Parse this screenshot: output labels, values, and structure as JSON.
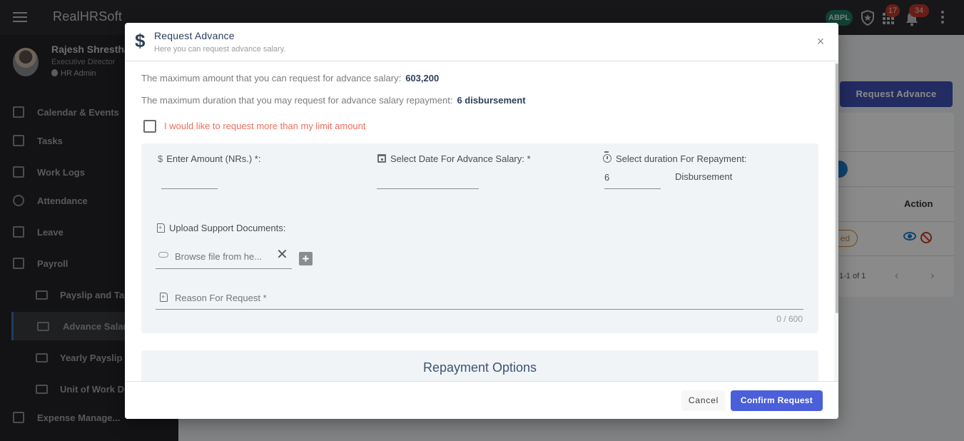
{
  "app": {
    "brand": "RealHRSoft",
    "company_badge": "ABPL",
    "apps_badge_count": "17",
    "notifications_count": "34"
  },
  "profile": {
    "name": "Rajesh Shrestha",
    "role": "Executive Director",
    "admin_label": "HR Admin"
  },
  "sidebar": {
    "items": [
      {
        "label": "Calendar & Events",
        "icon": "calendar-icon"
      },
      {
        "label": "Tasks",
        "icon": "tasks-icon"
      },
      {
        "label": "Work Logs",
        "icon": "clipboard-icon"
      },
      {
        "label": "Attendance",
        "icon": "fingerprint-icon"
      },
      {
        "label": "Leave",
        "icon": "calendar-x-icon"
      },
      {
        "label": "Payroll",
        "icon": "calculator-icon"
      },
      {
        "label": "Payslip and Tax",
        "icon": "money-icon"
      },
      {
        "label": "Advance Salary",
        "icon": "dollar-bill-icon",
        "active": true
      },
      {
        "label": "Yearly Payslip",
        "icon": "dollar-bill-icon"
      },
      {
        "label": "Unit of Work Done",
        "icon": "dollar-bill-icon"
      },
      {
        "label": "Expense Manage...",
        "icon": "clipboard-icon"
      }
    ]
  },
  "background_page": {
    "request_button": "Request Advance",
    "table_header_action": "Action",
    "status_fragment": "ed",
    "pagination": "1-1 of 1"
  },
  "modal": {
    "title": "Request Advance",
    "subtitle": "Here you can request advance salary.",
    "max_amount_text": "The maximum amount that you can request for advance salary:",
    "max_amount_value": "603,200",
    "max_duration_text": "The maximum duration that you may request for advance salary repayment:",
    "max_duration_value": "6 disbursement",
    "exceed_limit_label": "I would like to request more than my limit amount",
    "exceed_limit_checked": false,
    "amount_label": "Enter Amount (NRs.) *:",
    "amount_value": "",
    "date_label": "Select Date For Advance Salary: *",
    "date_value": "",
    "duration_label": "Select duration For Repayment:",
    "duration_value": "6",
    "duration_unit": "Disbursement",
    "upload_label": "Upload Support Documents:",
    "file_placeholder": "Browse file from he...",
    "reason_placeholder": "Reason For Request *",
    "reason_counter": "0 / 600",
    "repayment_title": "Repayment Options",
    "cancel_label": "Cancel",
    "confirm_label": "Confirm Request"
  }
}
